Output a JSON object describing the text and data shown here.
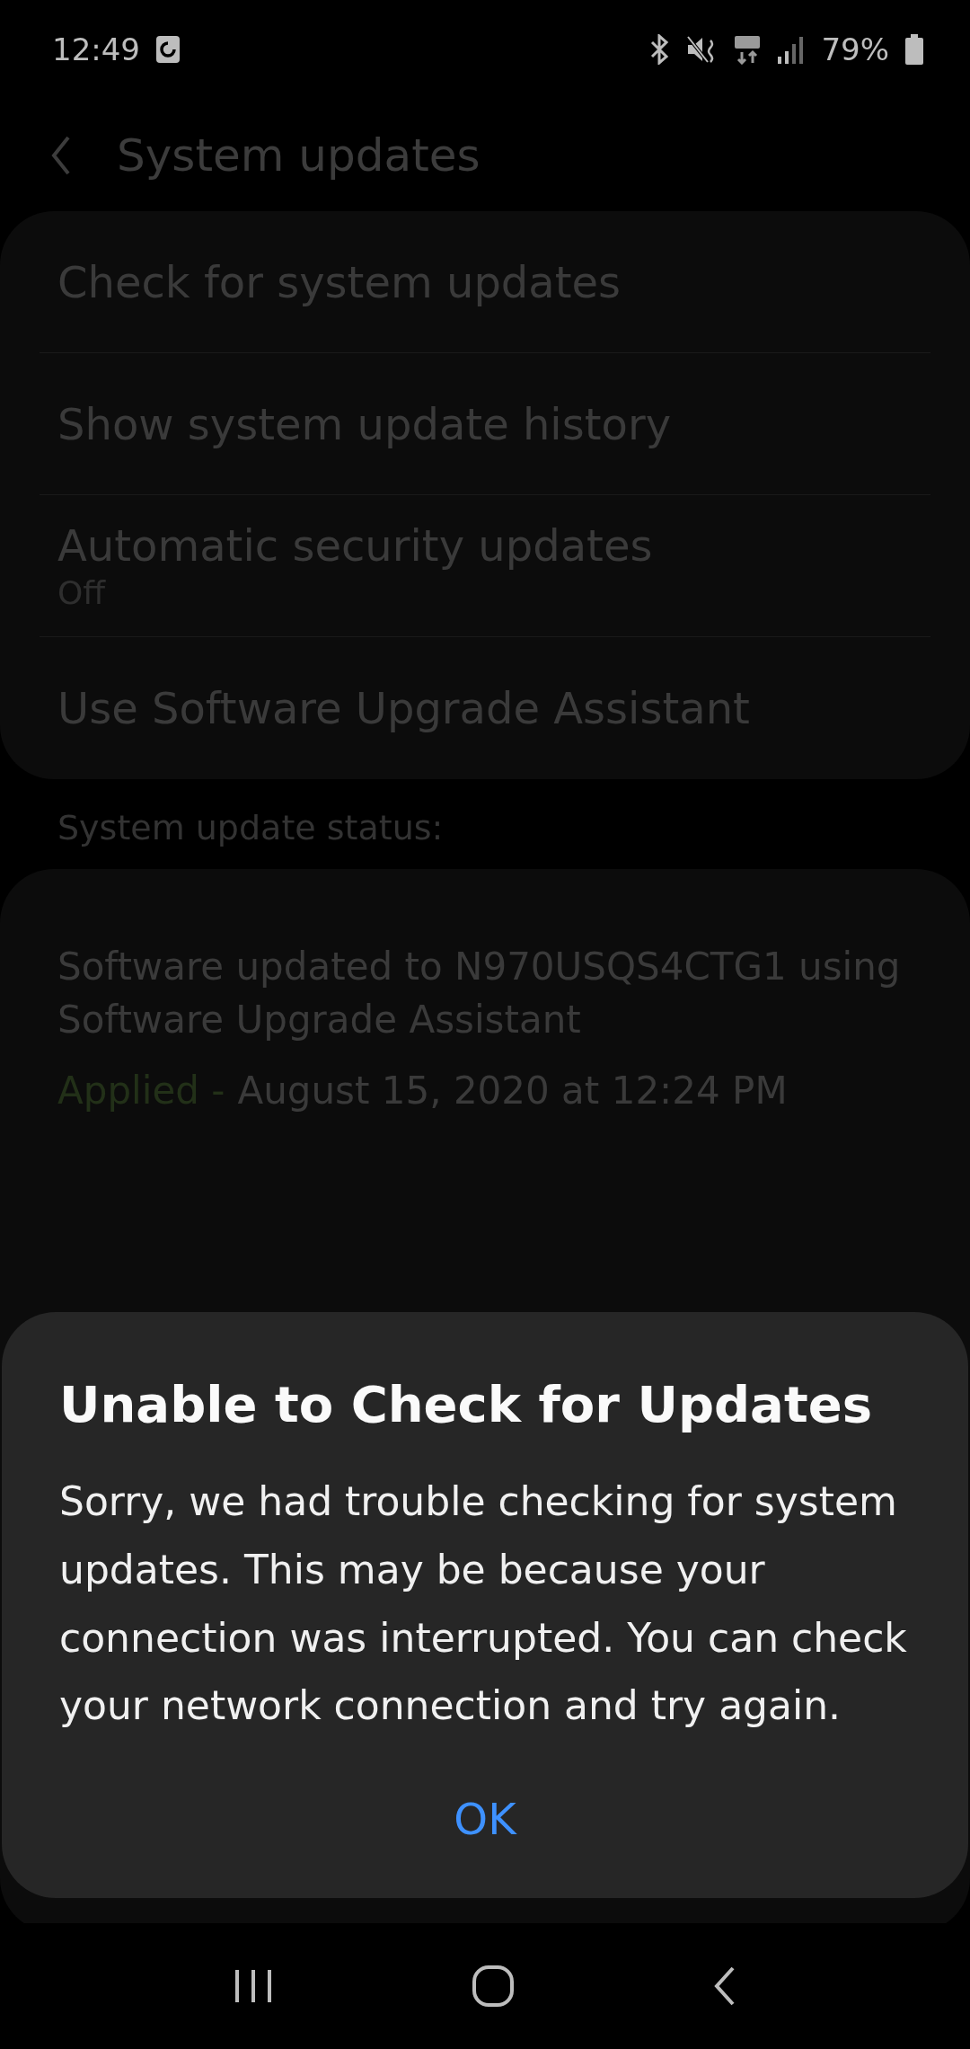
{
  "status_bar": {
    "time": "12:49",
    "battery": "79%"
  },
  "header": {
    "title": "System updates"
  },
  "settings": [
    {
      "title": "Check for system updates"
    },
    {
      "title": "Show system update history"
    },
    {
      "title": "Automatic security updates",
      "subtitle": "Off"
    },
    {
      "title": "Use Software Upgrade Assistant"
    }
  ],
  "status_section": {
    "heading": "System update status:",
    "message": "Software updated to N970USQS4CTG1 using Software Upgrade Assistant",
    "result": "Applied -",
    "date": "August 15, 2020 at 12:24 PM"
  },
  "dialog": {
    "title": "Unable to Check for Updates",
    "message": "Sorry, we had trouble checking for system updates. This may be because your connection was interrupted. You can check your network connection and try again.",
    "buttons": [
      "OK"
    ]
  }
}
